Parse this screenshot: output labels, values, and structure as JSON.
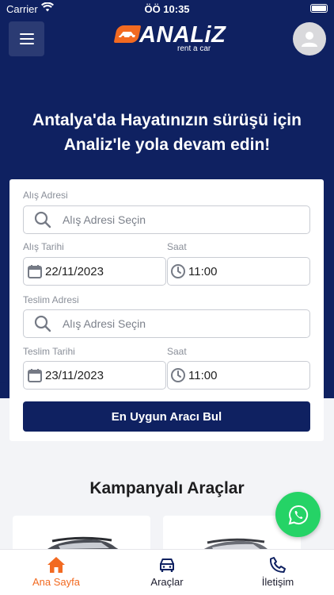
{
  "status_bar": {
    "carrier": "Carrier",
    "time": "ÖÖ 10:35"
  },
  "header": {
    "brand": "ANALiZ",
    "tagline": "rent a car",
    "menu_icon": "hamburger-icon",
    "profile_icon": "user-icon"
  },
  "hero": {
    "headline_line1": "Antalya'da Hayatınızın sürüşü için",
    "headline_line2": "Analiz'le yola devam edin!"
  },
  "search_form": {
    "pickup_address_label": "Alış Adresi",
    "pickup_address_placeholder": "Alış Adresi Seçin",
    "pickup_date_label": "Alış Tarihi",
    "pickup_date": "22/11/2023",
    "pickup_time_label": "Saat",
    "pickup_time": "11:00",
    "return_address_label": "Teslim Adresi",
    "return_address_placeholder": "Alış Adresi Seçin",
    "return_date_label": "Teslim Tarihi",
    "return_date": "23/11/2023",
    "return_time_label": "Saat",
    "return_time": "11:00",
    "submit_label": "En Uygun Aracı Bul"
  },
  "campaigns": {
    "title": "Kampanyalı Araçlar"
  },
  "tabbar": {
    "items": [
      {
        "label": "Ana Sayfa",
        "icon": "home-icon",
        "active": true
      },
      {
        "label": "Araçlar",
        "icon": "car-icon",
        "active": false
      },
      {
        "label": "İletişim",
        "icon": "phone-icon",
        "active": false
      }
    ]
  },
  "colors": {
    "primary": "#0f2161",
    "accent": "#f26a21",
    "whatsapp": "#25d366",
    "background": "#f3f4f7"
  }
}
